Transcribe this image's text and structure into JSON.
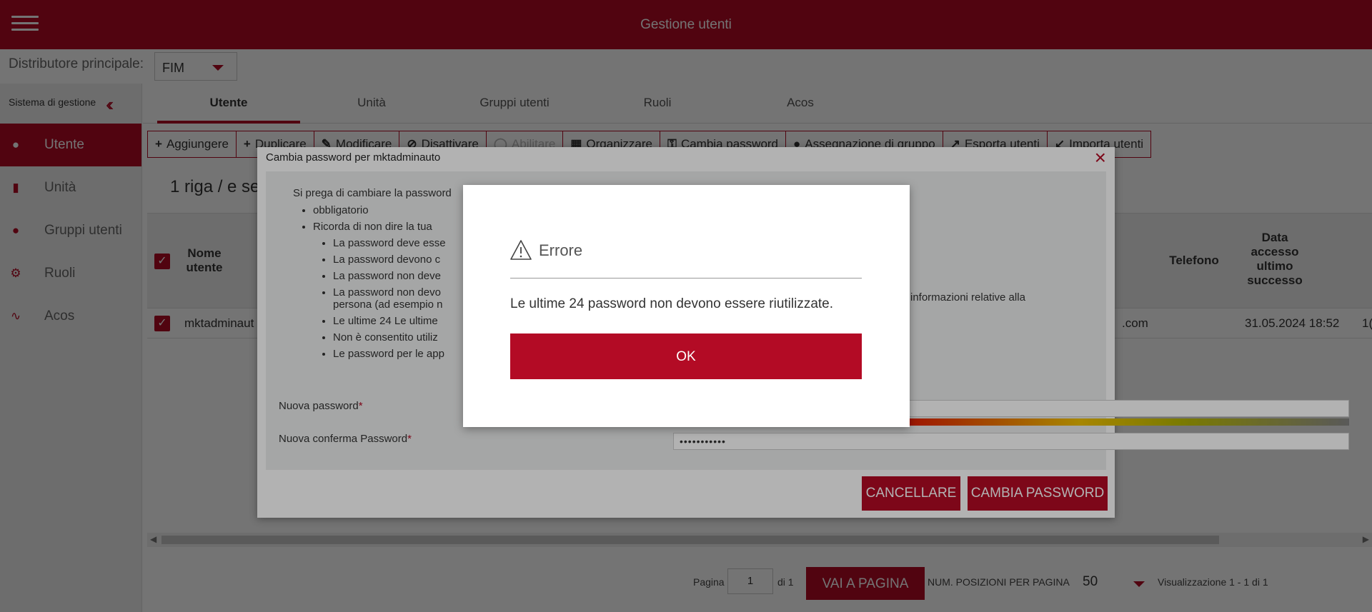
{
  "header": {
    "title": "Gestione utenti",
    "menu_icon": "hamburger-menu-icon"
  },
  "distributor": {
    "label": "Distributore principale:",
    "value": "FIM"
  },
  "sidebar": {
    "title": "Sistema di gestione",
    "items": [
      {
        "label": "Utente",
        "icon": "user-icon"
      },
      {
        "label": "Unità",
        "icon": "bar-chart-icon"
      },
      {
        "label": "Gruppi utenti",
        "icon": "users-icon"
      },
      {
        "label": "Ruoli",
        "icon": "gear-icon"
      },
      {
        "label": "Acos",
        "icon": "rss-icon"
      }
    ]
  },
  "tabs": [
    "Utente",
    "Unità",
    "Gruppi utenti",
    "Ruoli",
    "Acos"
  ],
  "toolbar": {
    "add": "Aggiungere",
    "duplicate": "Duplicare",
    "edit": "Modificare",
    "deactivate": "Disattivare",
    "activate": "Abilitare",
    "organize": "Organizzare",
    "change_password": "Cambia password",
    "group_assignment": "Assegnazione di gruppo",
    "export": "Esporta utenti",
    "import": "Importa utenti"
  },
  "grid": {
    "rows_info": "1 riga / e se",
    "columns": {
      "username": "Nome utente",
      "phone": "Telefono",
      "last_access": "Data accesso ultimo successo"
    },
    "row": {
      "username": "mktadminaut",
      "email_fragment": ".com",
      "last_access": "31.05.2024 18:52",
      "next_fragment": "1("
    }
  },
  "pager": {
    "page_label": "Pagina",
    "page_value": "1",
    "of_label": "di 1",
    "go_button": "VAI A PAGINA",
    "per_page_label": "NUM. POSIZIONI PER PAGINA",
    "per_page_value": "50",
    "display_info": "Visualizzazione 1 - 1 di 1"
  },
  "dialog": {
    "title": "Cambia password per mktadminauto",
    "intro": "Si prega di cambiare la password",
    "rules": {
      "mandatory": "obbligatorio",
      "remember": "Ricorda di non dire la tua",
      "sub": [
        "La password deve esse",
        "La password devono c",
        "La password non deve",
        "La password non devo",
        "Le ultime 24 Le ultime",
        "Non è consentito utiliz",
        "Le password per le app"
      ],
      "sub_continuation": "persona (ad esempio n",
      "tail_right": "informazioni relative alla"
    },
    "new_password_label": "Nuova password",
    "new_password_value": "•••••••••••",
    "confirm_password_label": "Nuova conferma Password",
    "confirm_password_value": "•••••••••••",
    "cancel_button": "CANCELLARE",
    "change_button": "CAMBIA PASSWORD"
  },
  "alert": {
    "title": "Errore",
    "message": "Le ultime 24 password non devono essere riutilizzate.",
    "ok_button": "OK"
  }
}
